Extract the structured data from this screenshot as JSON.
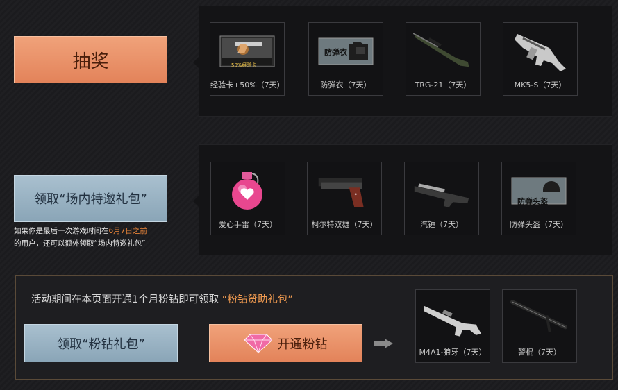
{
  "lottery": {
    "button_label": "抽奖",
    "items": [
      {
        "label": "经验卡+50%（7天）",
        "icon": "exp-card-icon",
        "card_text": "50%经验卡"
      },
      {
        "label": "防弹衣（7天）",
        "icon": "body-armor-icon",
        "card_text": "防弹衣"
      },
      {
        "label": "TRG-21（7天）",
        "icon": "sniper-rifle-icon"
      },
      {
        "label": "MK5-S（7天）",
        "icon": "smg-icon"
      }
    ]
  },
  "vip_gift": {
    "button_label": "领取“场内特邀礼包”",
    "note_prefix": "如果你是最后一次游戏时间在",
    "note_highlight": "6月7日之前",
    "note_suffix": "的用户，还可以额外领取“场内特邀礼包”",
    "items": [
      {
        "label": "爱心手雷（7天）",
        "icon": "heart-grenade-icon"
      },
      {
        "label": "柯尔特双雄（7天）",
        "icon": "pistol-icon"
      },
      {
        "label": "汽锤（7天）",
        "icon": "shotgun-icon"
      },
      {
        "label": "防弹头盔（7天）",
        "icon": "helmet-icon",
        "card_text": "防弹头盔"
      }
    ]
  },
  "pink_diamond": {
    "headline_prefix": "活动期间在本页面开通1个月粉钻即可领取",
    "headline_highlight": "“粉钻赞助礼包”",
    "claim_button_label": "领取“粉钻礼包”",
    "open_button_label": "开通粉钻",
    "items": [
      {
        "label": "M4A1-狼牙（7天）",
        "icon": "assault-rifle-icon"
      },
      {
        "label": "警棍（7天）",
        "icon": "baton-icon"
      }
    ]
  },
  "colors": {
    "orange_button": "#e8906a",
    "blue_button": "#9bb3c3",
    "highlight": "#f0883a",
    "frame_border": "#5a4a38"
  }
}
